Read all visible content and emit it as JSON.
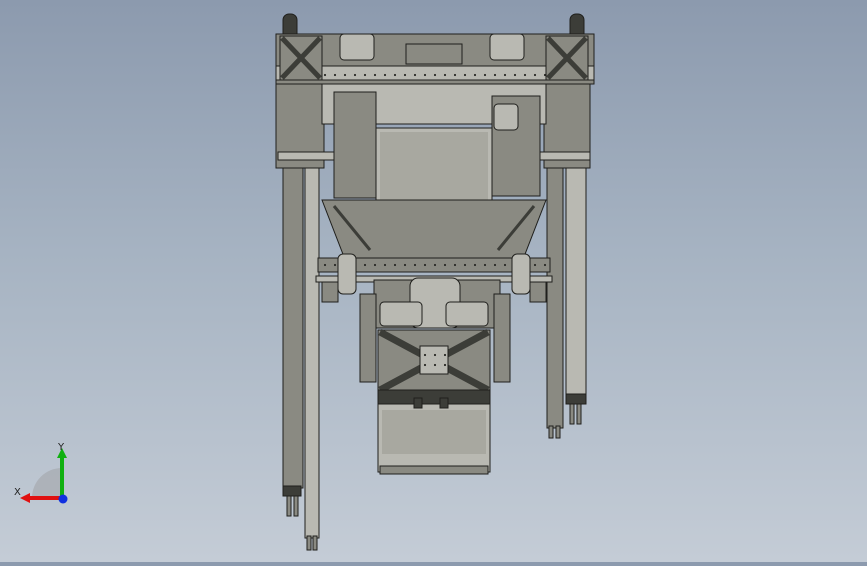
{
  "viewport": {
    "model_fill": "#8a8a82",
    "model_dark": "#3c3d38",
    "model_light": "#b9b9b2",
    "outline": "#1f1f1c"
  },
  "triad": {
    "x_label": "X",
    "y_label": "Y",
    "x_color": "#e01010",
    "y_color": "#10b010",
    "z_color": "#1030e0"
  }
}
